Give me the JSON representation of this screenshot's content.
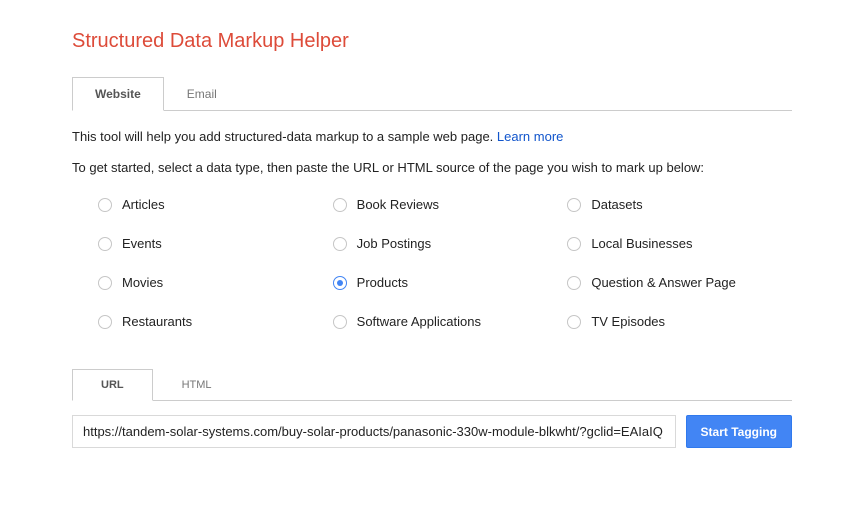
{
  "header": {
    "title": "Structured Data Markup Helper"
  },
  "type_tabs": {
    "items": [
      {
        "label": "Website",
        "active": true
      },
      {
        "label": "Email",
        "active": false
      }
    ]
  },
  "intro": {
    "text": "This tool will help you add structured-data markup to a sample web page. ",
    "learn_more": "Learn more"
  },
  "instruction": "To get started, select a data type, then paste the URL or HTML source of the page you wish to mark up below:",
  "data_types": [
    {
      "label": "Articles",
      "selected": false
    },
    {
      "label": "Book Reviews",
      "selected": false
    },
    {
      "label": "Datasets",
      "selected": false
    },
    {
      "label": "Events",
      "selected": false
    },
    {
      "label": "Job Postings",
      "selected": false
    },
    {
      "label": "Local Businesses",
      "selected": false
    },
    {
      "label": "Movies",
      "selected": false
    },
    {
      "label": "Products",
      "selected": true
    },
    {
      "label": "Question & Answer Page",
      "selected": false
    },
    {
      "label": "Restaurants",
      "selected": false
    },
    {
      "label": "Software Applications",
      "selected": false
    },
    {
      "label": "TV Episodes",
      "selected": false
    }
  ],
  "source_tabs": {
    "items": [
      {
        "label": "URL",
        "active": true
      },
      {
        "label": "HTML",
        "active": false
      }
    ]
  },
  "input": {
    "value": "https://tandem-solar-systems.com/buy-solar-products/panasonic-330w-module-blkwht/?gclid=EAIaIQ"
  },
  "actions": {
    "start_tagging": "Start Tagging"
  }
}
